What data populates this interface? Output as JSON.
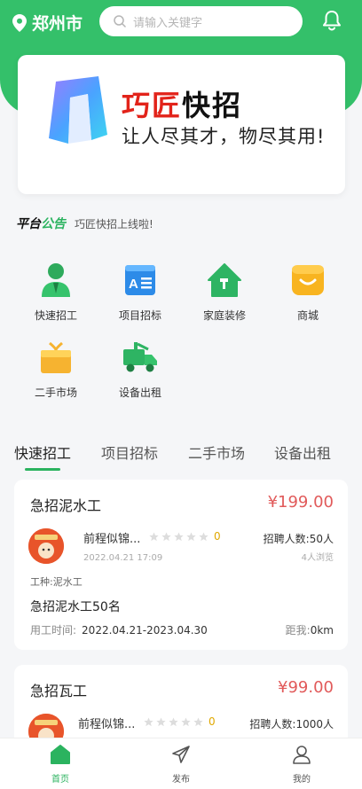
{
  "header": {
    "city": "郑州市",
    "search_placeholder": "请输入关键字"
  },
  "banner": {
    "title_red": "巧匠",
    "title_black": "快招",
    "slogan": "让人尽其才，物尽其用!"
  },
  "notice": {
    "tag_black": "平台",
    "tag_green": "公告",
    "text": "巧匠快招上线啦!"
  },
  "categories": [
    {
      "label": "快速招工",
      "icon": "worker-icon"
    },
    {
      "label": "项目招标",
      "icon": "document-icon"
    },
    {
      "label": "家庭装修",
      "icon": "house-hammer-icon"
    },
    {
      "label": "商城",
      "icon": "shop-icon"
    },
    {
      "label": "二手市场",
      "icon": "gift-box-icon"
    },
    {
      "label": "设备出租",
      "icon": "truck-icon"
    }
  ],
  "tabs": [
    "快速招工",
    "项目招标",
    "二手市场",
    "设备出租"
  ],
  "jobs": [
    {
      "title": "急招泥水工",
      "price": "¥199.00",
      "company": "前程似锦...",
      "rating": "0",
      "date": "2022.04.21 17:09",
      "recruit": "招聘人数:50人",
      "views": "4人浏览",
      "job_type": "工种:泥水工",
      "description": "急招泥水工50名",
      "work_time_label": "用工时间:",
      "work_time": "2022.04.21-2023.04.30",
      "distance_label": "距我:",
      "distance": "0km"
    },
    {
      "title": "急招瓦工",
      "price": "¥99.00",
      "company": "前程似锦...",
      "rating": "0",
      "recruit": "招聘人数:1000人"
    }
  ],
  "tabbar": [
    {
      "label": "首页",
      "icon": "home-icon"
    },
    {
      "label": "发布",
      "icon": "send-icon"
    },
    {
      "label": "我的",
      "icon": "user-icon"
    }
  ],
  "colors": {
    "brand_green": "#34c06a",
    "price_red": "#e15a5a",
    "rating_yellow": "#e0a800"
  }
}
